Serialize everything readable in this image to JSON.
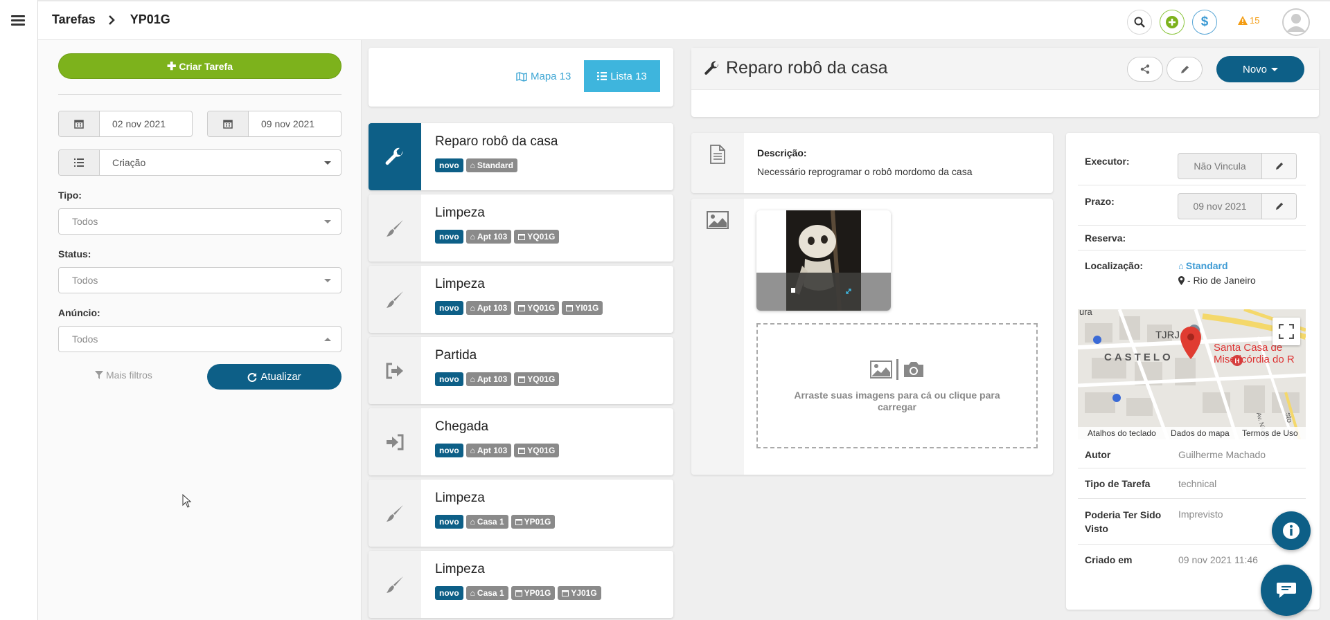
{
  "breadcrumb": {
    "root": "Tarefas",
    "current": "YP01G"
  },
  "header": {
    "alerts_count": "15",
    "icons": [
      "search-icon",
      "plus-icon",
      "dollar-icon",
      "warning-icon",
      "user-avatar"
    ]
  },
  "colors": {
    "primary": "#0d5f87",
    "green": "#7db21c",
    "light_blue": "#3eb5dd",
    "warning": "#f39c12"
  },
  "filters": {
    "create_task": "Criar Tarefa",
    "date_from": "02 nov 2021",
    "date_to": "09 nov 2021",
    "sort_by": "Criação",
    "tipo_label": "Tipo:",
    "tipo_value": "Todos",
    "status_label": "Status:",
    "status_value": "Todos",
    "anuncio_label": "Anúncio:",
    "anuncio_value": "Todos",
    "more_filters": "Mais filtros",
    "refresh": "Atualizar"
  },
  "view": {
    "map_label": "Mapa 13",
    "list_label": "Lista 13"
  },
  "tasks": [
    {
      "title": "Reparo robô da casa",
      "icon": "wrench-icon",
      "tags": [
        "novo",
        "Standard"
      ]
    },
    {
      "title": "Limpeza",
      "icon": "brush-icon",
      "tags": [
        "novo",
        "Apt 103",
        "YQ01G"
      ]
    },
    {
      "title": "Limpeza",
      "icon": "brush-icon",
      "tags": [
        "novo",
        "Apt 103",
        "YQ01G",
        "YI01G"
      ]
    },
    {
      "title": "Partida",
      "icon": "sign-out-icon",
      "tags": [
        "novo",
        "Apt 103",
        "YQ01G"
      ]
    },
    {
      "title": "Chegada",
      "icon": "sign-in-icon",
      "tags": [
        "novo",
        "Apt 103",
        "YQ01G"
      ]
    },
    {
      "title": "Limpeza",
      "icon": "brush-icon",
      "tags": [
        "novo",
        "Casa 1",
        "YP01G"
      ]
    },
    {
      "title": "Limpeza",
      "icon": "brush-icon",
      "tags": [
        "novo",
        "Casa 1",
        "YP01G",
        "YJ01G"
      ]
    }
  ],
  "detail": {
    "title": "Reparo robô da casa",
    "new_button": "Novo",
    "description_label": "Descrição:",
    "description_text": "Necessário reprogramar o robô mordomo da casa",
    "upload_text": "Arraste suas imagens para cá ou clique para carregar"
  },
  "info": {
    "executor_label": "Executor:",
    "executor_value": "Não Vincula",
    "prazo_label": "Prazo:",
    "prazo_value": "09 nov 2021",
    "reserva_label": "Reserva:",
    "localizacao_label": "Localização:",
    "localizacao_name": "Standard",
    "localizacao_city": "- Rio de Janeiro",
    "map": {
      "label_tjrj": "TJRJ",
      "label_castelo": "CASTELO",
      "label_santa_casa_1": "Santa Casa de",
      "label_santa_casa_2": "Misericórdia do R",
      "label_partial": "ura",
      "label_av": "Av. Nilo Peçanha",
      "label_sto": "sto",
      "marker_h": "H",
      "footer_shortcuts": "Atalhos do teclado",
      "footer_data": "Dados do mapa",
      "footer_terms": "Termos de Uso"
    },
    "autor_label": "Autor",
    "autor_value": "Guilherme Machado",
    "tipo_label": "Tipo de Tarefa",
    "tipo_value": "technical",
    "poderia_label": "Poderia Ter Sido Visto",
    "poderia_value": "Imprevisto",
    "criado_label": "Criado em",
    "criado_value": "09 nov 2021 11:46"
  }
}
